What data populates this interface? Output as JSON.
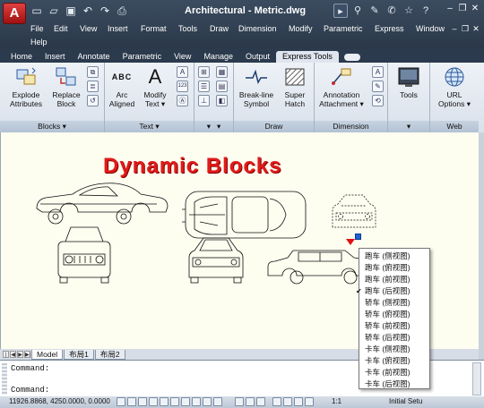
{
  "app": {
    "title": "Architectural - Metric.dwg",
    "app_icon": "A"
  },
  "qat_icons": [
    "new-icon",
    "open-icon",
    "save-icon",
    "undo-icon",
    "redo-icon",
    "plot-icon"
  ],
  "menubar": [
    "File",
    "Edit",
    "View",
    "Insert",
    "Format",
    "Tools",
    "Draw",
    "Dimension",
    "Modify",
    "Parametric",
    "Express",
    "Window",
    "Help"
  ],
  "ribbon_tabs": [
    "Home",
    "Insert",
    "Annotate",
    "Parametric",
    "View",
    "Manage",
    "Output",
    "Express Tools"
  ],
  "active_tab": "Express Tools",
  "panels": {
    "blocks": {
      "title": "Blocks",
      "explode": "Explode Attributes",
      "replace": "Replace Block"
    },
    "text": {
      "title": "Text",
      "arc": "Arc Aligned",
      "modify": "Modify Text",
      "abc": "ABC"
    },
    "draw": {
      "title": "Draw",
      "breakline": "Break-line Symbol",
      "superhatch": "Super Hatch"
    },
    "dimension": {
      "title": "Dimension",
      "annotation": "Annotation Attachment"
    },
    "tools": {
      "label": "Tools"
    },
    "web": {
      "title": "Web",
      "url": "URL Options"
    }
  },
  "drawing": {
    "heading": "Dynamic Blocks"
  },
  "layout_tabs": [
    "Model",
    "布局1",
    "布局2"
  ],
  "command": {
    "line1": "Command:",
    "line2": "Command:"
  },
  "status": {
    "coords": "11926.8868, 4250.0000, 0.0000",
    "scale": "1:1",
    "workspace": "Initial Setu"
  },
  "context_menu": {
    "items": [
      "跑车 (侧视图)",
      "跑车 (俯视图)",
      "跑车 (前视图)",
      "跑车 (后视图)",
      "轿车 (侧视图)",
      "轿车 (俯视图)",
      "轿车 (前视图)",
      "轿车 (后视图)",
      "卡车 (侧视图)",
      "卡车 (俯视图)",
      "卡车 (前视图)",
      "卡车 (后视图)"
    ],
    "checked_index": 3
  },
  "colors": {
    "heading_red": "#e11a1a",
    "grip_blue": "#1e64d0",
    "titlebar": "#2b3a4c"
  }
}
